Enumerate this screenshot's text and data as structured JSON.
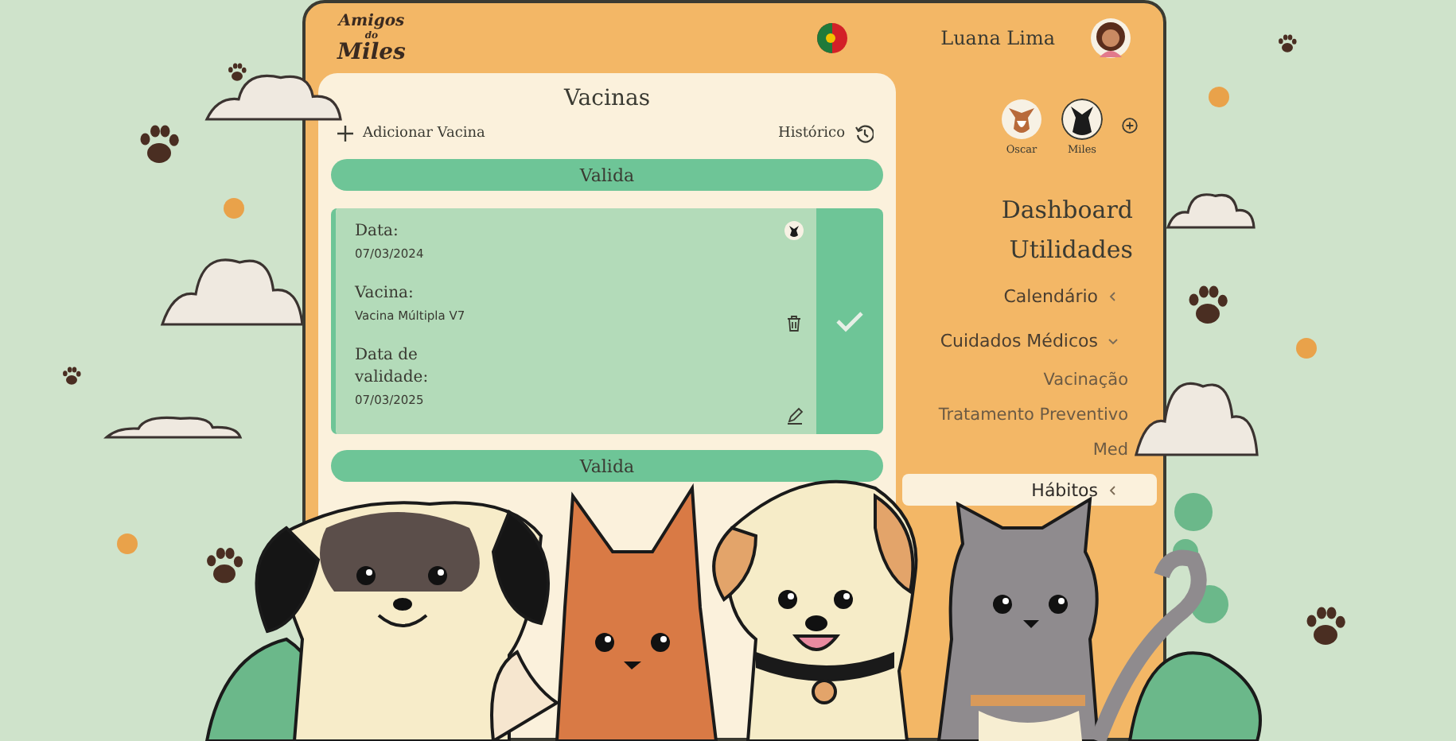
{
  "header": {
    "logo": [
      "Amigos",
      "do",
      "Miles"
    ],
    "user_name": "Luana Lima"
  },
  "vaccines": {
    "title": "Vacinas",
    "add_label": "Adicionar Vacina",
    "history_label": "Histórico",
    "groups": [
      {
        "status": "Valida",
        "records": [
          {
            "valid": true,
            "fields": [
              {
                "label": "Data:",
                "value": "07/03/2024"
              },
              {
                "label": "Vacina:",
                "value": "Vacina Múltipla V7"
              },
              {
                "label": "Data de validade:",
                "value": "07/03/2025"
              }
            ]
          }
        ]
      },
      {
        "status": "Valida"
      }
    ]
  },
  "pets": [
    {
      "name": "Oscar",
      "selected": false
    },
    {
      "name": "Miles",
      "selected": true
    }
  ],
  "nav": [
    {
      "kind": "heading",
      "label": "Dashboard"
    },
    {
      "kind": "heading",
      "label": "Utilidades"
    },
    {
      "kind": "menu",
      "label": "Calendário",
      "expanded": false,
      "selected": false
    },
    {
      "kind": "menu",
      "label": "Cuidados Médicos",
      "expanded": true,
      "selected": false,
      "children": [
        {
          "label": "Vacinação",
          "selected": false
        },
        {
          "label": "Tratamento Preventivo",
          "selected": false
        },
        {
          "label": "Med",
          "selected": false
        }
      ]
    },
    {
      "kind": "menu",
      "label": "Hábitos",
      "expanded": false,
      "selected": true
    }
  ]
}
